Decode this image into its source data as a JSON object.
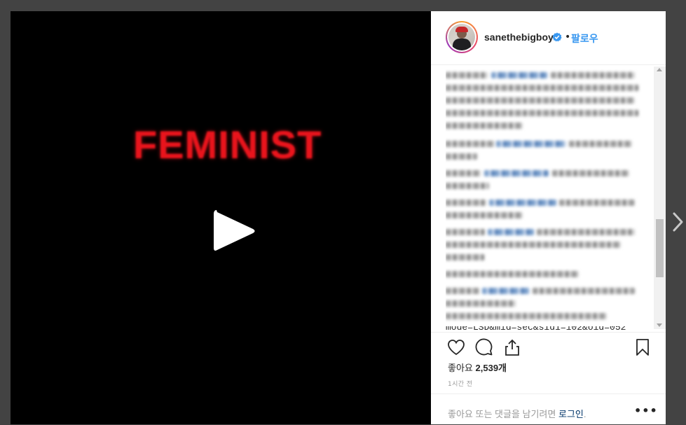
{
  "video": {
    "overlay_text": "FEMINIST",
    "text_color": "#e8141c",
    "play_icon": "play-icon"
  },
  "post": {
    "username": "sanethebigboy",
    "verified_icon": "verified-badge-icon",
    "separator": "•",
    "follow_label": "팔로우",
    "cut_comment_text": "mode=LSD&mid=sec&sid1=102&oid=052",
    "likes_label": "좋아요",
    "likes_count": "2,539개",
    "time_ago": "1시간 전",
    "login_prompt": "좋아요 또는 댓글을 남기려면",
    "login_link": "로그인",
    "login_suffix": ".",
    "more_label": "•••"
  },
  "icons": {
    "like": "heart-icon",
    "comment": "comment-icon",
    "share": "share-icon",
    "save": "bookmark-icon",
    "next": "chevron-right-icon"
  },
  "colors": {
    "accent": "#3897f0",
    "link": "#003569",
    "background": "#434343"
  }
}
